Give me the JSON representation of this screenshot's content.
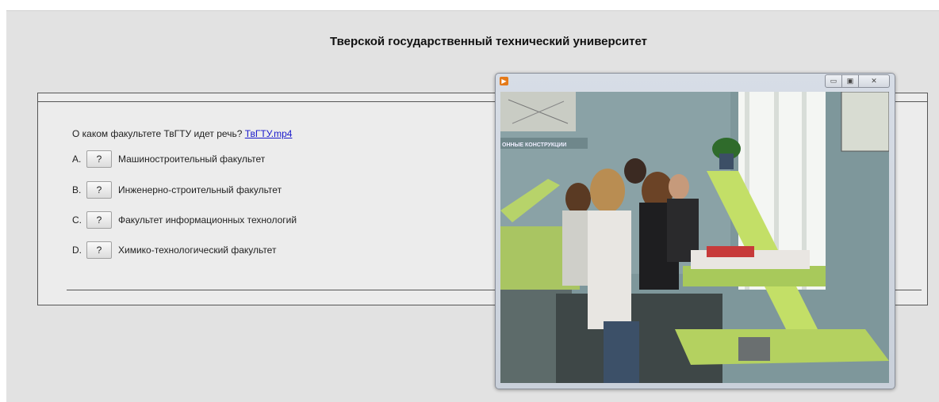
{
  "page": {
    "title": "Тверской государственный технический университет"
  },
  "quiz": {
    "question": "О каком факультете ТвГТУ идет речь?",
    "media_link": "ТвГТУ.mp4",
    "options": [
      {
        "letter": "A.",
        "button": "?",
        "text": "Машиностроительный факультет"
      },
      {
        "letter": "B.",
        "button": "?",
        "text": "Инженерно-строительный факультет"
      },
      {
        "letter": "C.",
        "button": "?",
        "text": "Факультет информационных технологий"
      },
      {
        "letter": "D.",
        "button": "?",
        "text": "Химико-технологический факультет"
      }
    ]
  },
  "player": {
    "app_icon": "media-player-icon",
    "controls": {
      "minimize": "▭",
      "maximize": "▣",
      "close": "✕"
    },
    "poster_sign": "ОННЫЕ КОНСТРУКЦИИ"
  }
}
